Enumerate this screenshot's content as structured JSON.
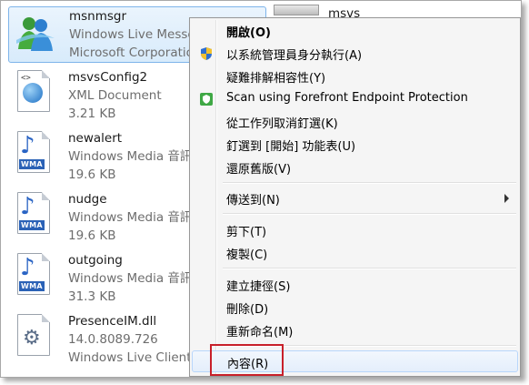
{
  "files": [
    {
      "name": "msnmsgr",
      "line2": "Windows Live Messen",
      "line3": "Microsoft Corporatio",
      "icon": "messenger-icon",
      "selected": true
    },
    {
      "name": "msvsConfig2",
      "line2": "XML Document",
      "line3": "3.21 KB",
      "icon": "xml-document-icon"
    },
    {
      "name": "newalert",
      "line2": "Windows Media 音訊",
      "line3": "19.6 KB",
      "icon": "wma-audio-icon"
    },
    {
      "name": "nudge",
      "line2": "Windows Media 音訊",
      "line3": "19.6 KB",
      "icon": "wma-audio-icon"
    },
    {
      "name": "outgoing",
      "line2": "Windows Media 音訊",
      "line3": "31.3 KB",
      "icon": "wma-audio-icon"
    },
    {
      "name": "PresenceIM.dll",
      "line2": "14.0.8089.726",
      "line3": "Windows Live Client P",
      "icon": "dll-gear-icon"
    }
  ],
  "right_peek": {
    "name": "msvs"
  },
  "menu": {
    "open": "開啟(O)",
    "run_as_admin": "以系統管理員身分執行(A)",
    "troubleshoot": "疑難排解相容性(Y)",
    "scan": "Scan using Forefront Endpoint Protection",
    "unpin_taskbar": "從工作列取消釘選(K)",
    "pin_start": "釘選到 [開始] 功能表(U)",
    "restore": "還原舊版(V)",
    "send_to": "傳送到(N)",
    "cut": "剪下(T)",
    "copy": "複製(C)",
    "shortcut": "建立捷徑(S)",
    "delete": "刪除(D)",
    "rename": "重新命名(M)",
    "properties": "內容(R)"
  },
  "colors": {
    "highlight_box": "#c8202a",
    "selection": "#d8ebfb"
  }
}
